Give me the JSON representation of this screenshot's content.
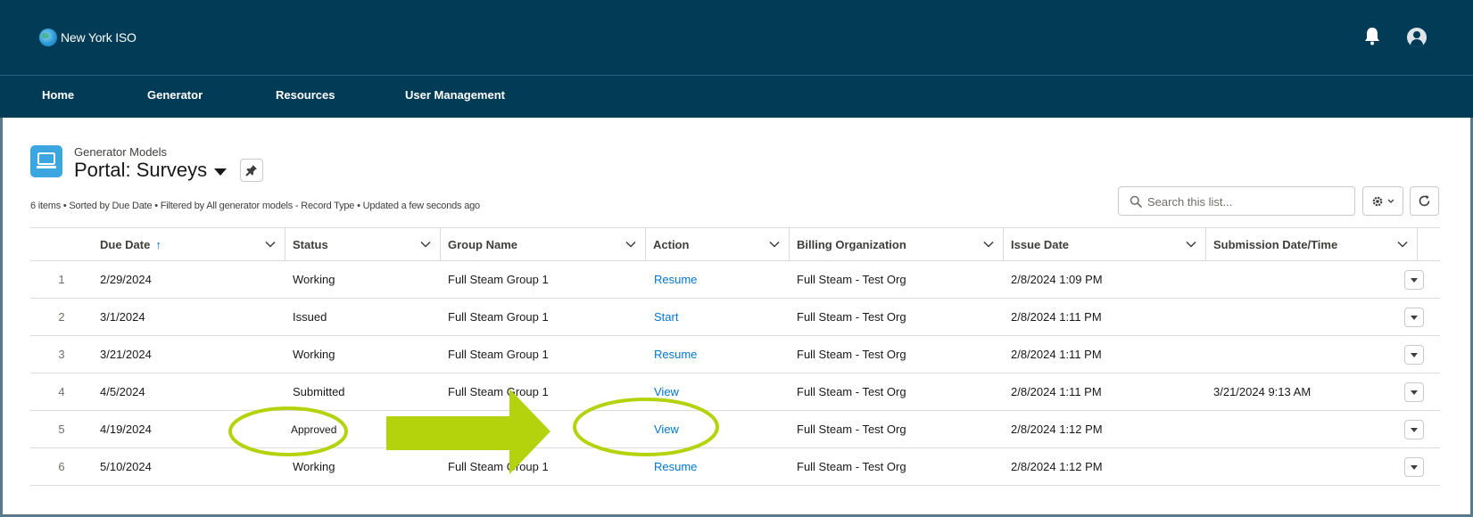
{
  "app": {
    "logo_text": "New York ISO",
    "nav": [
      "Home",
      "Generator",
      "Resources",
      "User Management"
    ]
  },
  "list_header": {
    "object_label": "Generator Models",
    "title": "Portal: Surveys",
    "info": "6 items • Sorted by Due Date • Filtered by All generator models - Record Type • Updated a few seconds ago"
  },
  "search": {
    "placeholder": "Search this list..."
  },
  "columns": [
    "Due Date",
    "Status",
    "Group Name",
    "Action",
    "Billing Organization",
    "Issue Date",
    "Submission Date/Time"
  ],
  "rows": [
    {
      "num": "1",
      "due_date": "2/29/2024",
      "status": "Working",
      "group": "Full Steam Group 1",
      "action": "Resume",
      "billing": "Full Steam - Test Org",
      "issue": "2/8/2024 1:09 PM",
      "submission": ""
    },
    {
      "num": "2",
      "due_date": "3/1/2024",
      "status": "Issued",
      "group": "Full Steam Group 1",
      "action": "Start",
      "billing": "Full Steam - Test Org",
      "issue": "2/8/2024 1:11 PM",
      "submission": ""
    },
    {
      "num": "3",
      "due_date": "3/21/2024",
      "status": "Working",
      "group": "Full Steam Group 1",
      "action": "Resume",
      "billing": "Full Steam - Test Org",
      "issue": "2/8/2024 1:11 PM",
      "submission": ""
    },
    {
      "num": "4",
      "due_date": "4/5/2024",
      "status": "Submitted",
      "group": "Full Steam Group 1",
      "action": "View",
      "billing": "Full Steam - Test Org",
      "issue": "2/8/2024 1:11 PM",
      "submission": "3/21/2024 9:13 AM"
    },
    {
      "num": "5",
      "due_date": "4/19/2024",
      "status": "Approved",
      "group": "",
      "action": "View",
      "billing": "Full Steam - Test Org",
      "issue": "2/8/2024 1:12 PM",
      "submission": ""
    },
    {
      "num": "6",
      "due_date": "5/10/2024",
      "status": "Working",
      "group": "Full Steam Group 1",
      "action": "Resume",
      "billing": "Full Steam - Test Org",
      "issue": "2/8/2024 1:12 PM",
      "submission": ""
    }
  ],
  "colors": {
    "header_bg": "#013b55",
    "link": "#0176d3",
    "annotation": "#b5d30c",
    "object_icon": "#3ba6e0"
  }
}
